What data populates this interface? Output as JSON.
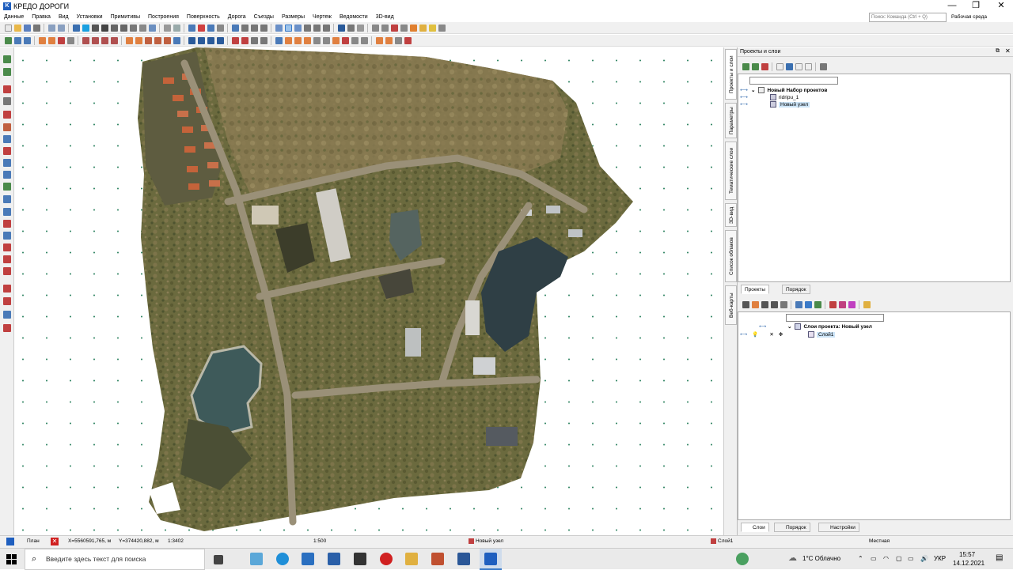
{
  "window": {
    "title": "КРЕДО ДОРОГИ",
    "minimize": "—",
    "maximize": "❐",
    "close": "✕"
  },
  "menu": [
    "Данные",
    "Правка",
    "Вид",
    "Установки",
    "Примитивы",
    "Построения",
    "Поверхность",
    "Дорога",
    "Съезды",
    "Размеры",
    "Чертеж",
    "Ведомости",
    "3D-вид"
  ],
  "search": {
    "placeholder": "Поиск: Команда (Ctrl + Q)"
  },
  "workspace": "Рабочая среда",
  "side_tabs": [
    "Проекты и слои",
    "Параметры",
    "Тематические слои",
    "3D-вид",
    "Список облаков",
    "Веб-карты"
  ],
  "panel": {
    "title": "Проекты и слои",
    "project_tree": {
      "root": "Новый Набор проектов",
      "children": [
        "ridripu_1",
        "Новый узел"
      ]
    },
    "mid_tabs": [
      "Проекты",
      "Порядок"
    ],
    "layer_tree": {
      "root": "Слои проекта: Новый узел",
      "children": [
        "Слой1"
      ]
    },
    "bottom_tabs": [
      "Слои",
      "Порядок",
      "Настройки"
    ]
  },
  "status": {
    "view": "План",
    "x": "X=5560591,765, м",
    "y": "Y=374420,882, м",
    "scale_ratio": "1:3402",
    "scale": "1:500",
    "node": "Новый узел",
    "layer": "Слой1",
    "system": "Местная"
  },
  "taskbar": {
    "search_placeholder": "Введите здесь текст для поиска",
    "weather": "1°C Облачно",
    "language": "УКР",
    "time": "15:57",
    "date": "14.12.2021"
  },
  "colors": {
    "accent": "#1f5fbf",
    "selection": "#cce4f7",
    "terrain": "#6b6a3e",
    "water": "#3e5a5a"
  }
}
